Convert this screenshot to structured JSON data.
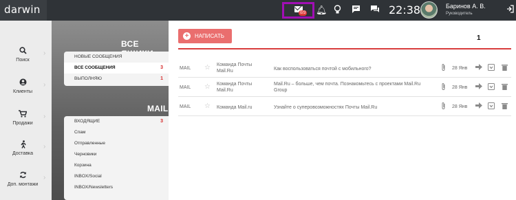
{
  "topbar": {
    "logo": "darwin",
    "mail_counter": "0/3",
    "clock": "22:38",
    "user_name": "Баринов А. В.",
    "user_role": "Руководитель"
  },
  "nav": {
    "items": [
      {
        "label": "Поиск",
        "icon": "search-icon"
      },
      {
        "label": "Клиенты",
        "icon": "user-icon"
      },
      {
        "label": "Продажи",
        "icon": "cart-icon"
      },
      {
        "label": "Доставка",
        "icon": "runner-icon"
      },
      {
        "label": "Доп. монтажи",
        "icon": "refresh-icon"
      }
    ]
  },
  "folders": {
    "all_title": "ВСЕ ЯЩИКИ",
    "all_items": [
      {
        "label": "НОВЫЕ СООБЩЕНИЯ",
        "count": ""
      },
      {
        "label": "ВСЕ СООБЩЕНИЯ",
        "count": "3"
      },
      {
        "label": "ВЫПОЛНЯЮ",
        "count": "1"
      }
    ],
    "mail_title": "MAIL",
    "mail_items": [
      {
        "label": "ВХОДЯЩИЕ",
        "count": "3"
      },
      {
        "label": "Спам",
        "count": ""
      },
      {
        "label": "Отправленные",
        "count": ""
      },
      {
        "label": "Черновики",
        "count": ""
      },
      {
        "label": "Корзина",
        "count": ""
      },
      {
        "label": "INBOX/Social",
        "count": ""
      },
      {
        "label": "INBOX/Newsletters",
        "count": ""
      }
    ]
  },
  "main": {
    "compose_label": "НАПИСАТЬ",
    "page_number": "1",
    "rows": [
      {
        "tag": "MAIL",
        "from": "Команда Почты Mail.Ru",
        "subject": "Как воспользоваться почтой с мобильного?",
        "date": "28 Янв"
      },
      {
        "tag": "MAIL",
        "from": "Команда Почты Mail.Ru",
        "subject": "Mail.Ru – больше, чем почта. Познакомьтесь с проектами Mail.Ru Group",
        "date": "28 Янв"
      },
      {
        "tag": "MAIL",
        "from": "Команда Mail.ru",
        "subject": "Узнайте о суперовозможностях Почты Mail.Ru",
        "date": "28 Янв"
      }
    ]
  },
  "colors": {
    "accent": "#ea6e6e",
    "highlight": "#a10fb5",
    "topbar": "#2f3337"
  }
}
